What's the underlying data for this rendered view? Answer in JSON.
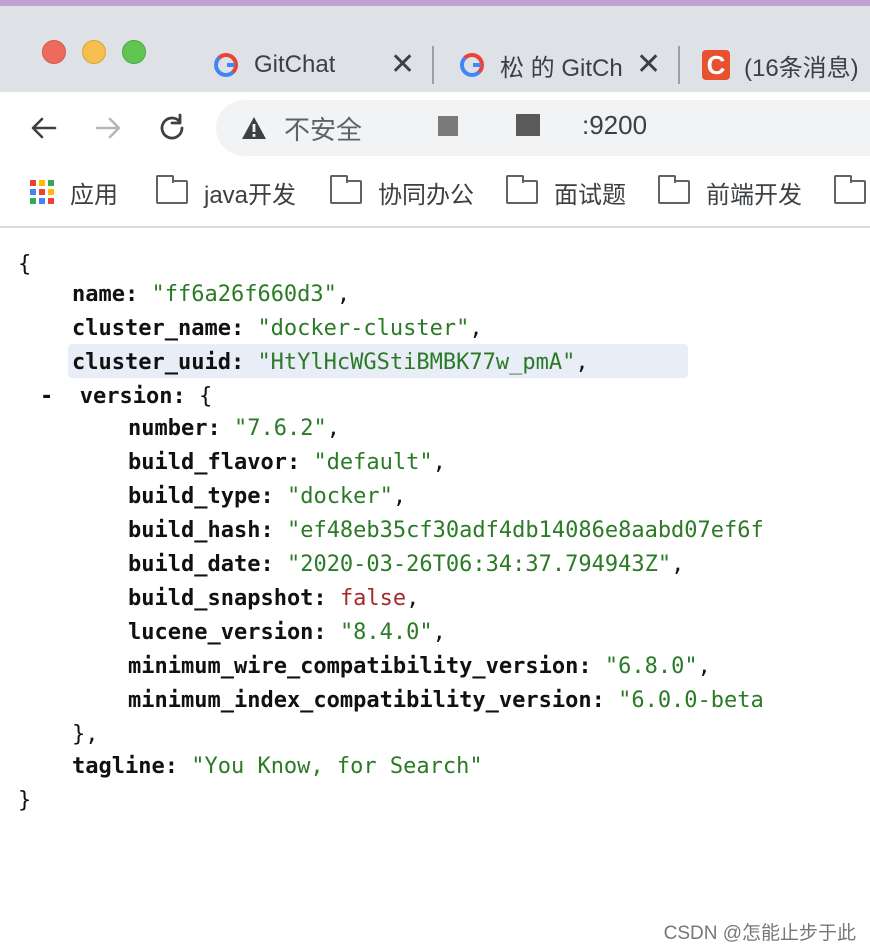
{
  "browser": {
    "tabs": [
      {
        "title": "GitChat",
        "favicon": "google-g-icon"
      },
      {
        "title": "松 的 GitCh",
        "favicon": "google-g-icon"
      },
      {
        "title": "(16条消息)",
        "favicon": "csdn-icon",
        "favicon_letter": "C"
      }
    ],
    "tab_close_glyph": "✕",
    "address": {
      "security_label": "不安全",
      "url_tail": ":9200"
    },
    "bookmarks": [
      {
        "label": "应用",
        "icon": "apps-grid-icon"
      },
      {
        "label": "java开发",
        "icon": "folder-icon"
      },
      {
        "label": "协同办公",
        "icon": "folder-icon"
      },
      {
        "label": "面试题",
        "icon": "folder-icon"
      },
      {
        "label": "前端开发",
        "icon": "folder-icon"
      }
    ]
  },
  "json_view": {
    "open_brace": "{",
    "close_brace": "}",
    "name_key": "name:",
    "name_val": "\"ff6a26f660d3\"",
    "cluster_name_key": "cluster_name:",
    "cluster_name_val": "\"docker-cluster\"",
    "cluster_uuid_key": "cluster_uuid:",
    "cluster_uuid_val": "\"HtYlHcWGStiBMBK77w_pmA\"",
    "version_toggle": "-",
    "version_key": "version:",
    "version_open": "{",
    "number_key": "number:",
    "number_val": "\"7.6.2\"",
    "build_flavor_key": "build_flavor:",
    "build_flavor_val": "\"default\"",
    "build_type_key": "build_type:",
    "build_type_val": "\"docker\"",
    "build_hash_key": "build_hash:",
    "build_hash_val": "\"ef48eb35cf30adf4db14086e8aabd07ef6f",
    "build_date_key": "build_date:",
    "build_date_val": "\"2020-03-26T06:34:37.794943Z\"",
    "build_snapshot_key": "build_snapshot:",
    "build_snapshot_val": "false",
    "lucene_version_key": "lucene_version:",
    "lucene_version_val": "\"8.4.0\"",
    "min_wire_key": "minimum_wire_compatibility_version:",
    "min_wire_val": "\"6.8.0\"",
    "min_index_key": "minimum_index_compatibility_version:",
    "min_index_val": "\"6.0.0-beta",
    "version_close": "},",
    "tagline_key": "tagline:",
    "tagline_val": "\"You Know, for Search\""
  },
  "watermark": "CSDN @怎能止步于此",
  "colors": {
    "string": "#2a7a26",
    "boolean": "#a52a2a",
    "selection": "#e8edf7"
  }
}
